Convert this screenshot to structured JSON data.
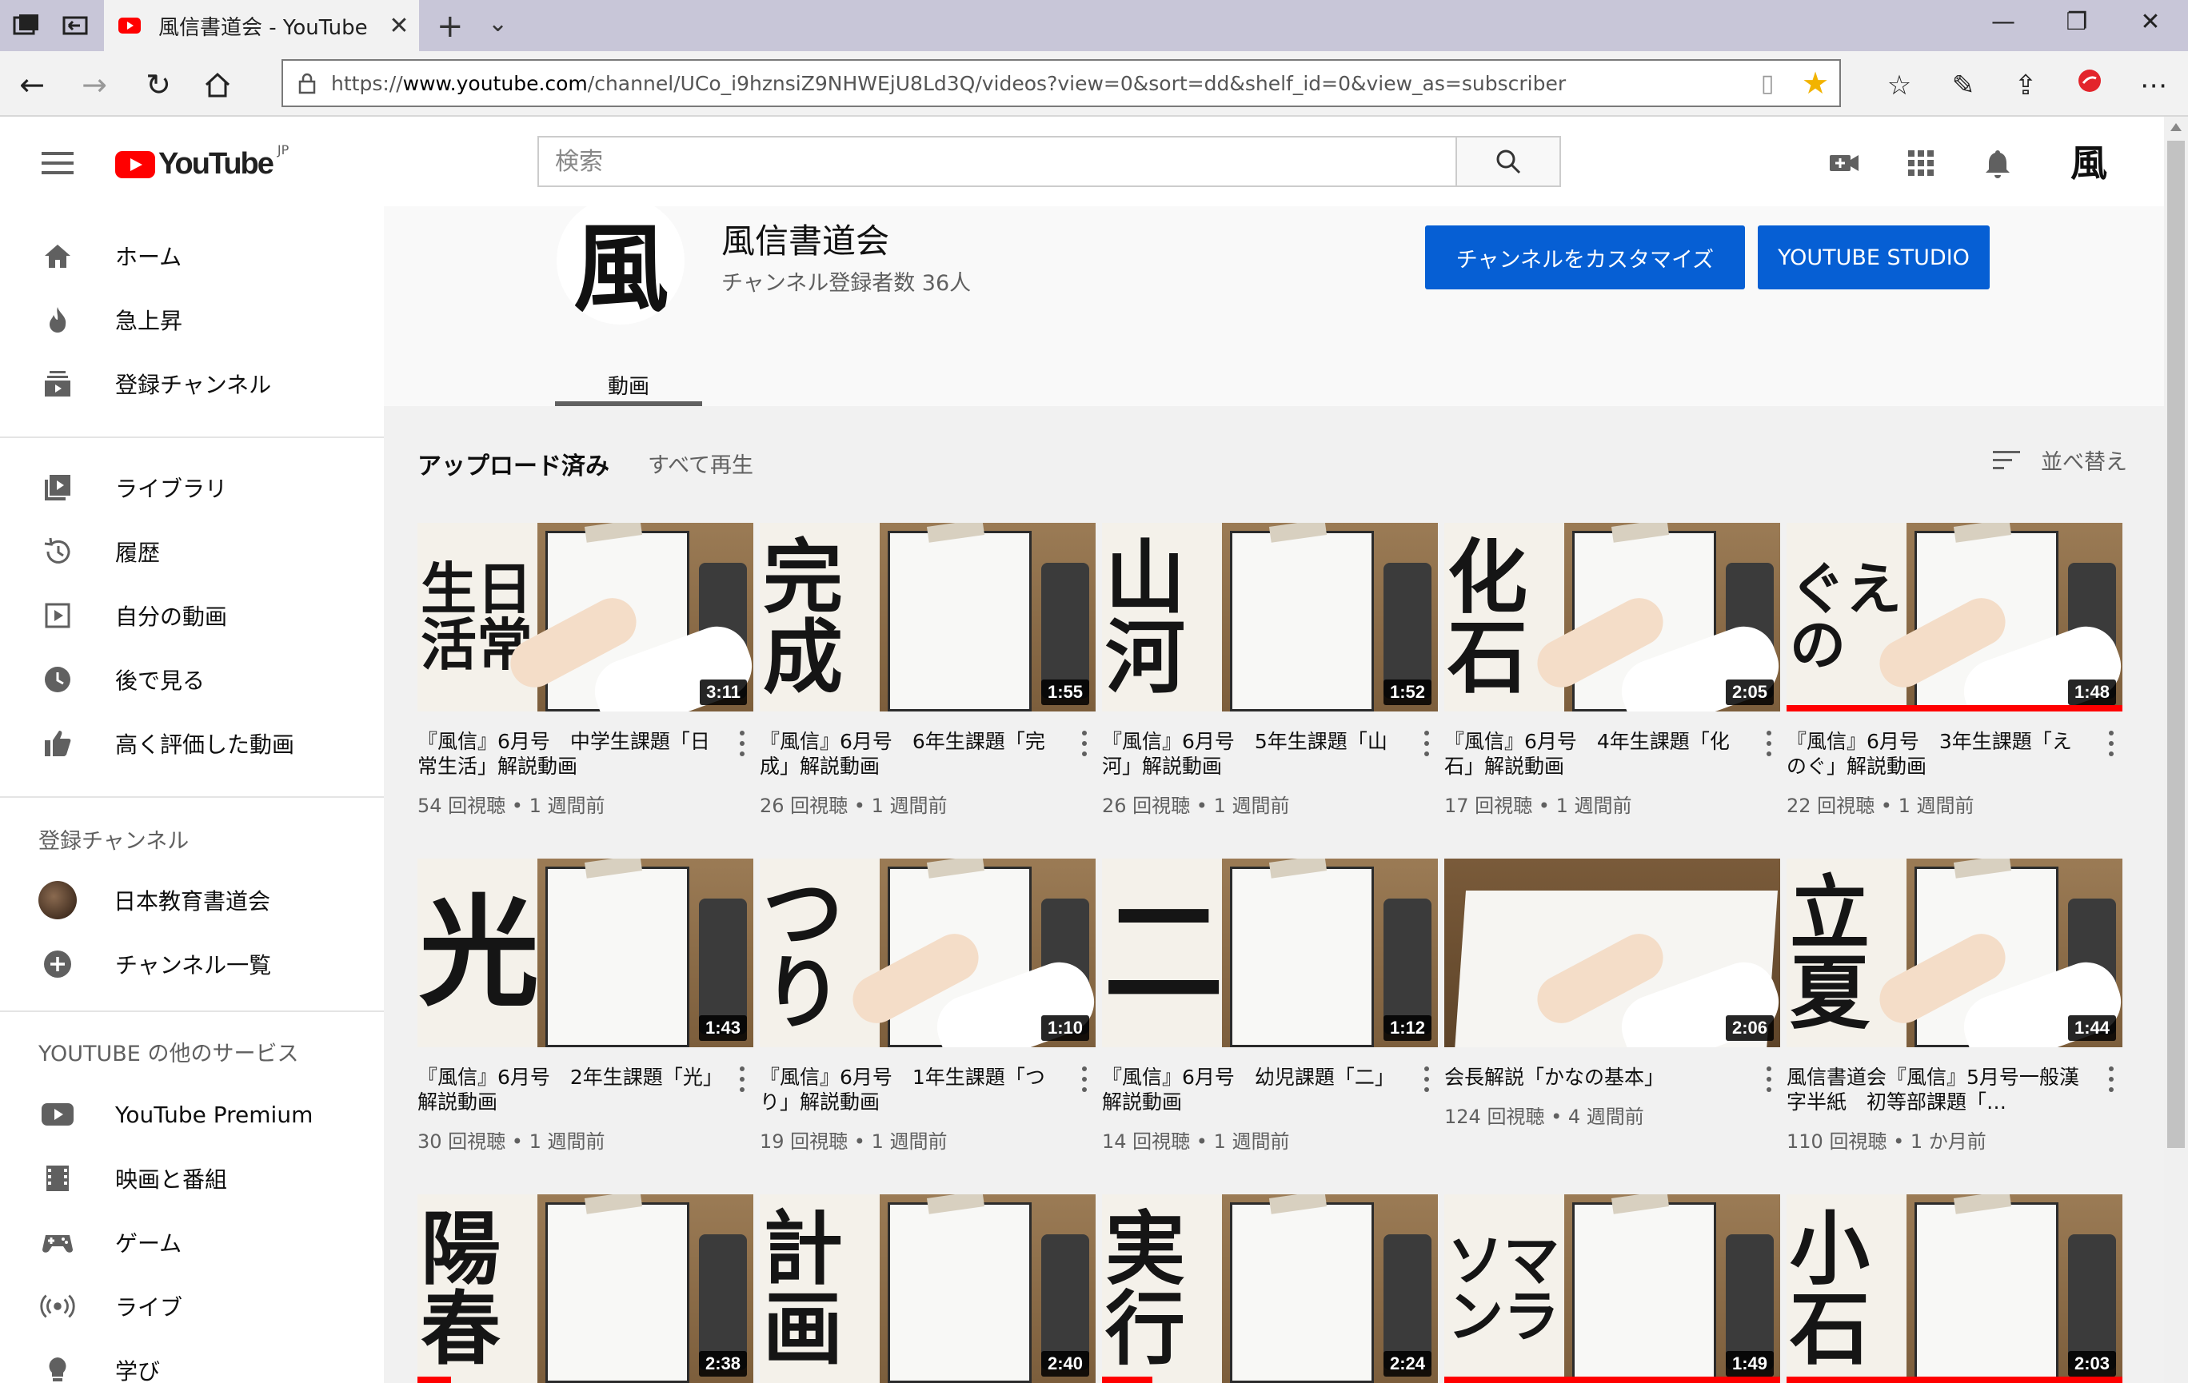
{
  "browser": {
    "tab_title": "風信書道会 - YouTube",
    "url_prefix": "https://",
    "url_host": "www.youtube.com",
    "url_path": "/channel/UCo_i9hznsiZ9NHWEjU8Ld3Q/videos?view=0&sort=dd&shelf_id=0&view_as=subscriber"
  },
  "masthead": {
    "logo_text": "YouTube",
    "logo_region": "JP",
    "search_placeholder": "検索"
  },
  "sidebar": {
    "main": [
      {
        "label": "ホーム",
        "icon": "home-icon"
      },
      {
        "label": "急上昇",
        "icon": "trending-icon"
      },
      {
        "label": "登録チャンネル",
        "icon": "subscriptions-icon"
      }
    ],
    "library": [
      {
        "label": "ライブラリ",
        "icon": "library-icon"
      },
      {
        "label": "履歴",
        "icon": "history-icon"
      },
      {
        "label": "自分の動画",
        "icon": "your-videos-icon"
      },
      {
        "label": "後で見る",
        "icon": "watch-later-icon"
      },
      {
        "label": "高く評価した動画",
        "icon": "liked-icon"
      }
    ],
    "subs_heading": "登録チャンネル",
    "subs": [
      {
        "label": "日本教育書道会",
        "icon": "channel-avatar"
      },
      {
        "label": "チャンネル一覧",
        "icon": "add-circle-icon"
      }
    ],
    "more_heading": "YOUTUBE の他のサービス",
    "more": [
      {
        "label": "YouTube Premium",
        "icon": "youtube-icon"
      },
      {
        "label": "映画と番組",
        "icon": "film-icon"
      },
      {
        "label": "ゲーム",
        "icon": "gaming-icon"
      },
      {
        "label": "ライブ",
        "icon": "live-icon"
      },
      {
        "label": "学び",
        "icon": "learning-icon"
      }
    ]
  },
  "channel": {
    "avatar_glyph": "風",
    "name": "風信書道会",
    "subscribers": "チャンネル登録者数 36人",
    "customize_label": "チャンネルをカスタマイズ",
    "studio_label": "YOUTUBE STUDIO",
    "tab_videos": "動画"
  },
  "section": {
    "title": "アップロード済み",
    "play_all": "すべて再生",
    "sort_label": "並べ替え"
  },
  "videos": [
    {
      "title": "『風信』6月号　中学生課題「日常生活」解説動画",
      "meta": "54 回視聴 • 1 週間前",
      "duration": "3:11",
      "kanji": "生日活常",
      "watched": 0
    },
    {
      "title": "『風信』6月号　6年生課題「完成」解説動画",
      "meta": "26 回視聴 • 1 週間前",
      "duration": "1:55",
      "kanji": "完成",
      "watched": 0
    },
    {
      "title": "『風信』6月号　5年生課題「山河」解説動画",
      "meta": "26 回視聴 • 1 週間前",
      "duration": "1:52",
      "kanji": "山河",
      "watched": 0
    },
    {
      "title": "『風信』6月号　4年生課題「化石」解説動画",
      "meta": "17 回視聴 • 1 週間前",
      "duration": "2:05",
      "kanji": "化石",
      "watched": 0
    },
    {
      "title": "『風信』6月号　3年生課題「えのぐ」解説動画",
      "meta": "22 回視聴 • 1 週間前",
      "duration": "1:48",
      "kanji": "ぐえの",
      "watched": 1.0
    },
    {
      "title": "『風信』6月号　2年生課題「光」解説動画",
      "meta": "30 回視聴 • 1 週間前",
      "duration": "1:43",
      "kanji": "光",
      "watched": 0
    },
    {
      "title": "『風信』6月号　1年生課題「つり」解説動画",
      "meta": "19 回視聴 • 1 週間前",
      "duration": "1:10",
      "kanji": "つり",
      "watched": 0
    },
    {
      "title": "『風信』6月号　幼児課題「二」解説動画",
      "meta": "14 回視聴 • 1 週間前",
      "duration": "1:12",
      "kanji": "二",
      "watched": 0
    },
    {
      "title": "会長解説「かなの基本」",
      "meta": "124 回視聴 • 4 週間前",
      "duration": "2:06",
      "kanji": "",
      "watched": 0
    },
    {
      "title": "風信書道会『風信』5月号一般漢字半紙　初等部課題「…",
      "meta": "110 回視聴 • 1 か月前",
      "duration": "1:44",
      "kanji": "立夏",
      "watched": 0
    },
    {
      "title": "",
      "meta": "",
      "duration": "2:38",
      "kanji": "陽春",
      "watched": 0.1
    },
    {
      "title": "",
      "meta": "",
      "duration": "2:40",
      "kanji": "計画",
      "watched": 0
    },
    {
      "title": "",
      "meta": "",
      "duration": "2:24",
      "kanji": "実行",
      "watched": 0.15
    },
    {
      "title": "",
      "meta": "",
      "duration": "1:49",
      "kanji": "ソマンラ",
      "watched": 1.0
    },
    {
      "title": "",
      "meta": "",
      "duration": "2:03",
      "kanji": "小石",
      "watched": 1.0
    }
  ],
  "colors": {
    "accent_blue": "#065fd4",
    "yt_red": "#ff0000"
  }
}
